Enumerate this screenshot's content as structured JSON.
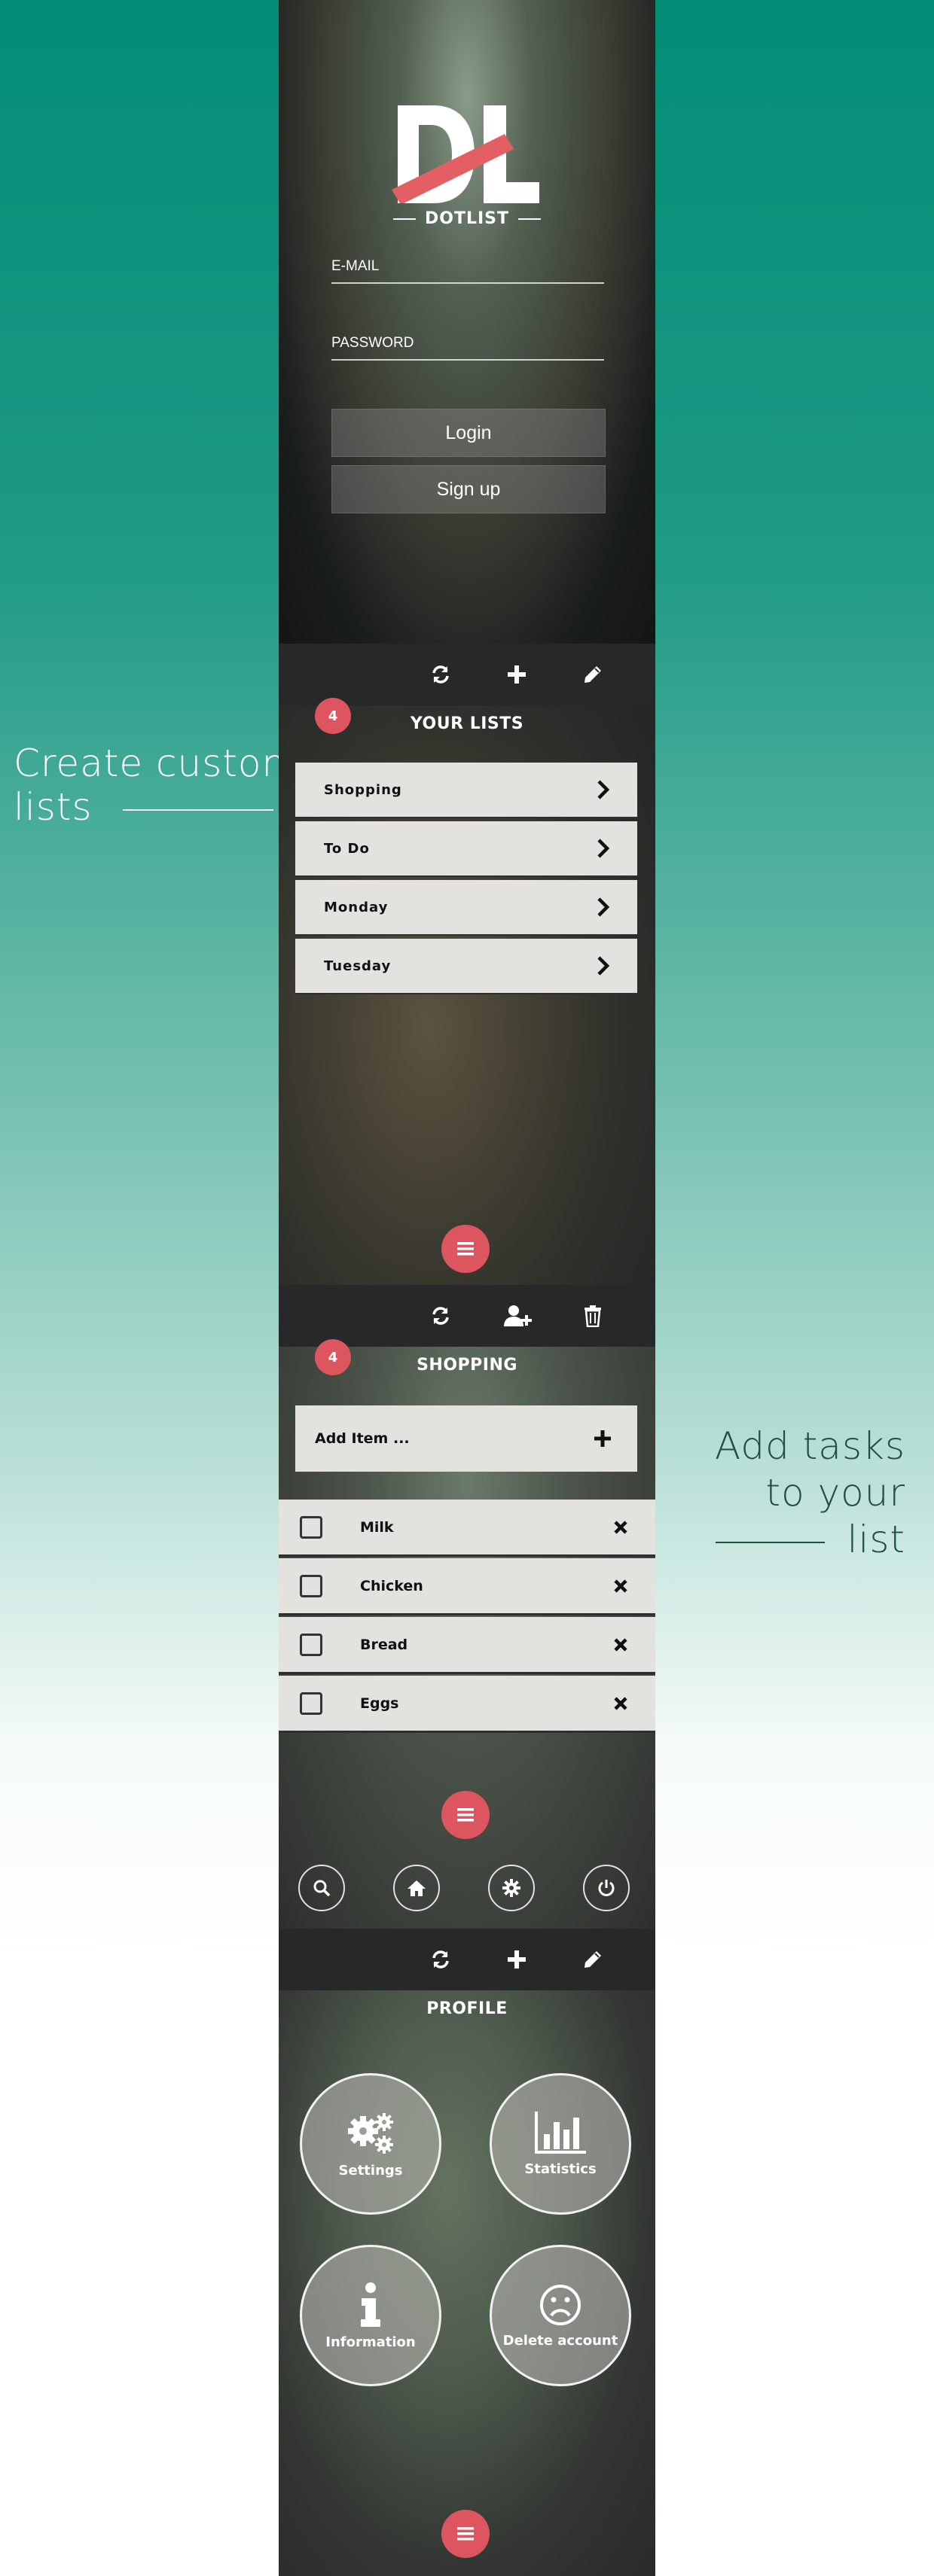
{
  "captions": {
    "left": {
      "line1": "Create custom",
      "line2": "lists"
    },
    "right": {
      "line1": "Add tasks",
      "line2": "to your",
      "line3": "list"
    }
  },
  "login": {
    "logo_letters": "DL",
    "app_name": "DOTLIST",
    "email_placeholder": "E-MAIL",
    "password_placeholder": "PASSWORD",
    "login_label": "Login",
    "signup_label": "Sign up"
  },
  "lists_screen": {
    "title": "YOUR LISTS",
    "badge_count": "4",
    "items": [
      {
        "label": "Shopping"
      },
      {
        "label": "To Do"
      },
      {
        "label": "Monday"
      },
      {
        "label": "Tuesday"
      }
    ]
  },
  "shopping_screen": {
    "title": "SHOPPING",
    "badge_count": "4",
    "add_item_placeholder": "Add Item ...",
    "tasks": [
      {
        "label": "Milk"
      },
      {
        "label": "Chicken"
      },
      {
        "label": "Bread"
      },
      {
        "label": "Eggs"
      }
    ]
  },
  "profile_screen": {
    "title": "PROFILE",
    "tiles": [
      {
        "label": "Settings",
        "icon": "gears-icon"
      },
      {
        "label": "Statistics",
        "icon": "bar-chart-icon"
      },
      {
        "label": "Information",
        "icon": "info-icon"
      },
      {
        "label": "Delete account",
        "icon": "sad-face-icon"
      }
    ]
  },
  "colors": {
    "accent": "#dd555f",
    "teal": "#028d77",
    "toolbar": "#272829",
    "row": "#e3e2df"
  }
}
